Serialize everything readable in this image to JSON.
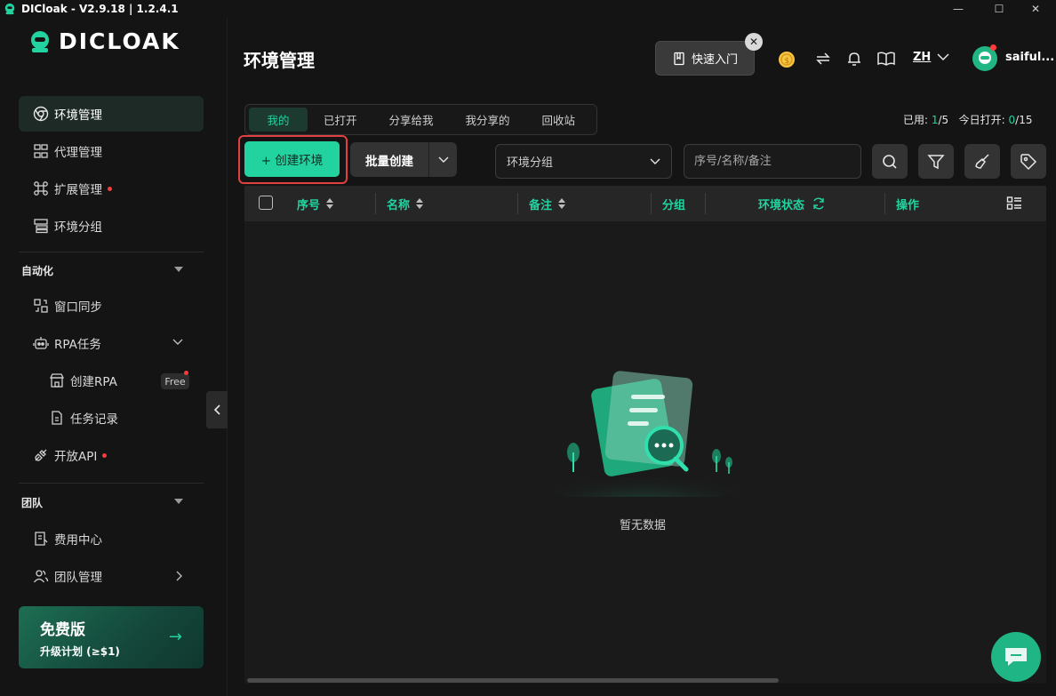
{
  "window": {
    "title": "DICloak - V2.9.18 | 1.2.4.1",
    "controls": {
      "minimize": "—",
      "maximize": "☐",
      "close": "✕"
    }
  },
  "sidebar": {
    "logo": "DICLOAK",
    "items": [
      {
        "label": "环境管理",
        "icon": "chrome-icon",
        "active": true
      },
      {
        "label": "代理管理",
        "icon": "proxy-icon"
      },
      {
        "label": "扩展管理",
        "icon": "extension-icon",
        "dot": true
      },
      {
        "label": "环境分组",
        "icon": "group-icon"
      }
    ],
    "automation": {
      "label": "自动化",
      "items": [
        {
          "label": "窗口同步",
          "icon": "sync-icon"
        },
        {
          "label": "RPA任务",
          "icon": "robot-icon"
        },
        {
          "label": "创建RPA",
          "icon": "store-icon",
          "tag": "Free"
        },
        {
          "label": "任务记录",
          "icon": "document-icon"
        },
        {
          "label": "开放API",
          "icon": "api-icon",
          "dot": true
        }
      ]
    },
    "team": {
      "label": "团队",
      "items": [
        {
          "label": "费用中心",
          "icon": "billing-icon"
        },
        {
          "label": "团队管理",
          "icon": "users-icon"
        }
      ]
    },
    "upgrade": {
      "title": "免费版",
      "subtitle": "升级计划 (≥$1)",
      "arrow": "→"
    }
  },
  "header": {
    "title": "环境管理",
    "quick_start": "快速入门",
    "quick_close": "✕",
    "language": "ZH",
    "username": "saiful..."
  },
  "tabs": [
    "我的",
    "已打开",
    "分享给我",
    "我分享的",
    "回收站"
  ],
  "usage": {
    "used_label": "已用:",
    "used_value": "1",
    "used_total": "/5",
    "opened_label": "今日打开:",
    "opened_value": "0",
    "opened_total": "/15"
  },
  "toolbar": {
    "create": "+ 创建环境",
    "batch_create": "批量创建",
    "group_select": "环境分组",
    "search_placeholder": "序号/名称/备注"
  },
  "table": {
    "columns": [
      "序号",
      "名称",
      "备注",
      "分组",
      "环境状态",
      "操作"
    ],
    "empty_text": "暂无数据"
  },
  "colors": {
    "accent": "#22d3a0",
    "background": "#141414",
    "highlight_border": "#e04040"
  }
}
